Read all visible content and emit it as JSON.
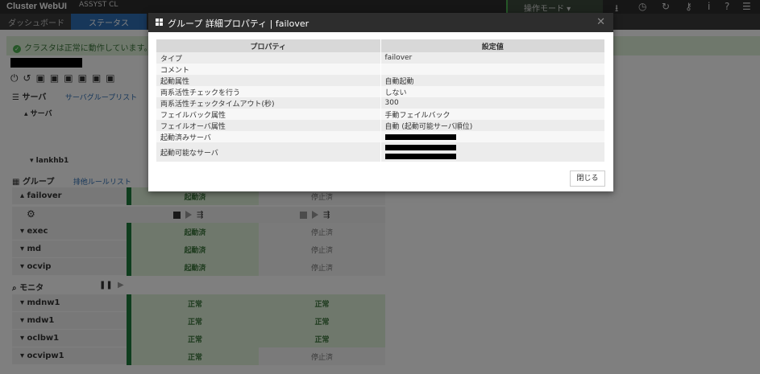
{
  "app": {
    "title": "Cluster WebUI",
    "cluster": "ASSYST CL",
    "mode": "操作モード"
  },
  "tabs": [
    {
      "label": "ダッシュボード"
    },
    {
      "label": "ステータス"
    }
  ],
  "alert": {
    "text": "クラスタは正常に動作しています。"
  },
  "sections": {
    "servers": {
      "label": "サーバ",
      "link": "サーバグループリスト",
      "sub": "サーバ",
      "host": "lankhb1"
    },
    "groups": {
      "label": "グループ",
      "link": "排他ルールリスト"
    },
    "monitors": {
      "label": "モニタ"
    }
  },
  "groups": [
    {
      "name": "failover",
      "s1": "起動済",
      "s2": "停止済"
    },
    {
      "name": "exec",
      "s1": "起動済",
      "s2": "停止済"
    },
    {
      "name": "md",
      "s1": "起動済",
      "s2": "停止済"
    },
    {
      "name": "ocvip",
      "s1": "起動済",
      "s2": "停止済"
    }
  ],
  "monitors": [
    {
      "name": "mdnw1",
      "s1": "正常",
      "s2": "正常"
    },
    {
      "name": "mdw1",
      "s1": "正常",
      "s2": "正常"
    },
    {
      "name": "oclbw1",
      "s1": "正常",
      "s2": "正常"
    },
    {
      "name": "ocvipw1",
      "s1": "正常",
      "s2": "停止済"
    }
  ],
  "modal": {
    "title": "グループ 詳細プロパティ | failover",
    "col_property": "プロパティ",
    "col_value": "設定値",
    "rows": [
      {
        "prop": "タイプ",
        "value": "failover"
      },
      {
        "prop": "コメント",
        "value": ""
      },
      {
        "prop": "起動属性",
        "value": "自動起動"
      },
      {
        "prop": "両系活性チェックを行う",
        "value": "しない"
      },
      {
        "prop": "両系活性チェックタイムアウト(秒)",
        "value": "300"
      },
      {
        "prop": "フェイルバック属性",
        "value": "手動フェイルバック"
      },
      {
        "prop": "フェイルオーバ属性",
        "value": "自動 (起動可能サーバ順位)"
      },
      {
        "prop": "起動済みサーバ",
        "value": ""
      },
      {
        "prop": "起動可能なサーバ",
        "value": ""
      }
    ],
    "close_label": "閉じる"
  }
}
